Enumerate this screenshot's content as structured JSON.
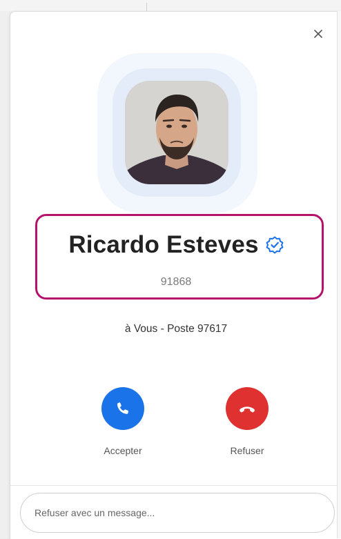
{
  "call": {
    "caller_name": "Ricardo Esteves",
    "caller_number": "91868",
    "target": "à Vous - Poste 97617",
    "verified": true
  },
  "actions": {
    "accept_label": "Accepter",
    "decline_label": "Refuser"
  },
  "message": {
    "placeholder": "Refuser avec un message..."
  },
  "icons": {
    "close": "close-icon",
    "verified": "verified-badge-icon",
    "accept": "phone-icon",
    "decline": "hang-up-icon"
  },
  "colors": {
    "accept": "#1a73e8",
    "decline": "#e03131",
    "highlight": "#b5126b",
    "verified": "#1a73e8"
  }
}
